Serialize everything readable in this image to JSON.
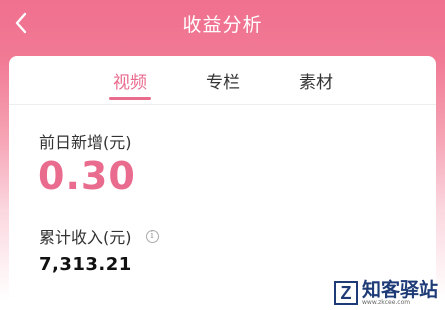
{
  "header": {
    "title": "收益分析"
  },
  "tabs": [
    {
      "label": "视频",
      "active": true
    },
    {
      "label": "专栏",
      "active": false
    },
    {
      "label": "素材",
      "active": false
    }
  ],
  "stats": {
    "yesterday_label": "前日新增(元)",
    "yesterday_value": "0.30",
    "total_label": "累计收入(元)",
    "total_value": "7,313.21",
    "info_icon_glyph": "i"
  },
  "watermark": {
    "logo_letter": "Z",
    "text": "知客驿站",
    "url": "www.zkcee.com"
  },
  "colors": {
    "accent": "#e96b8e",
    "header": "#f0708f",
    "watermark": "#1e3b78"
  }
}
